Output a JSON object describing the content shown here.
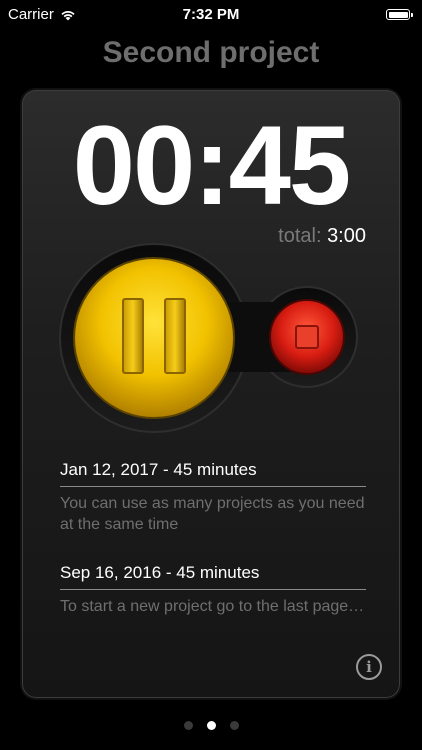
{
  "status_bar": {
    "carrier": "Carrier",
    "time": "7:32 PM"
  },
  "project": {
    "title": "Second project"
  },
  "timer": {
    "elapsed": "00:45",
    "total_label": "total:",
    "total_value": "3:00"
  },
  "colors": {
    "pause_button": "#f2c200",
    "stop_button": "#e0291c",
    "background": "#000000",
    "card": "#1e1e1e"
  },
  "history": [
    {
      "date": "Jan 12, 2017 - 45 minutes",
      "note": "You can use as many projects as you need at the same time"
    },
    {
      "date": "Sep 16, 2016 - 45 minutes",
      "note": "To start a new project go to the last page…"
    }
  ],
  "info": {
    "label": "i"
  },
  "pagination": {
    "pages": 3,
    "current": 2
  }
}
